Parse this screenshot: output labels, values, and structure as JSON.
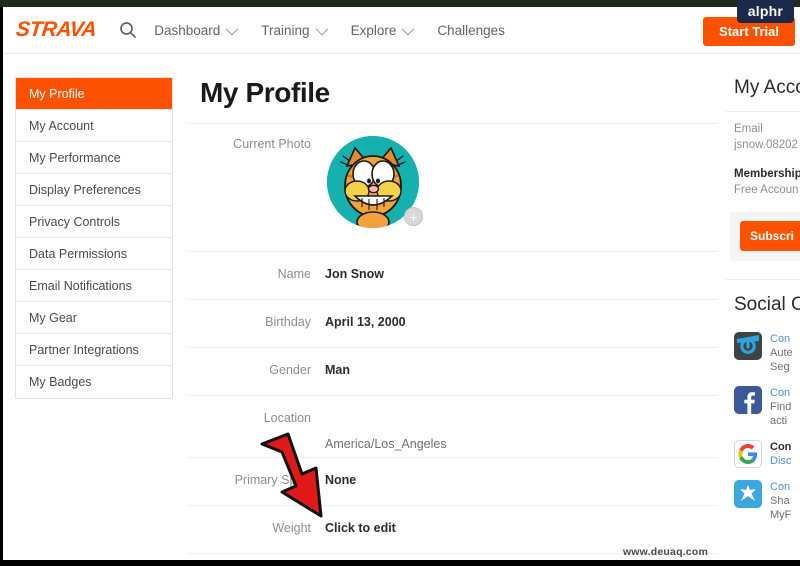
{
  "branding": {
    "site_logo": "STRAVA",
    "overlay_badge": "alphr",
    "watermark": "www.deuaq.com",
    "accent_color": "#fc5200",
    "badge_color": "#1b2a4a"
  },
  "navbar": {
    "search_icon": "search-icon",
    "items": [
      {
        "label": "Dashboard",
        "has_caret": true
      },
      {
        "label": "Training",
        "has_caret": true
      },
      {
        "label": "Explore",
        "has_caret": true
      },
      {
        "label": "Challenges",
        "has_caret": false
      }
    ],
    "cta_label": "Start Trial"
  },
  "sidebar": {
    "items": [
      {
        "label": "My Profile",
        "active": true
      },
      {
        "label": "My Account",
        "active": false
      },
      {
        "label": "My Performance",
        "active": false
      },
      {
        "label": "Display Preferences",
        "active": false
      },
      {
        "label": "Privacy Controls",
        "active": false
      },
      {
        "label": "Data Permissions",
        "active": false
      },
      {
        "label": "Email Notifications",
        "active": false
      },
      {
        "label": "My Gear",
        "active": false
      },
      {
        "label": "Partner Integrations",
        "active": false
      },
      {
        "label": "My Badges",
        "active": false
      }
    ]
  },
  "main": {
    "title": "My Profile",
    "photo_row": {
      "label": "Current Photo",
      "avatar_alt": "garfield-avatar",
      "add_badge": "+"
    },
    "fields": [
      {
        "label": "Name",
        "value": "Jon Snow",
        "style": "bold"
      },
      {
        "label": "Birthday",
        "value": "April 13, 2000",
        "style": "bold"
      },
      {
        "label": "Gender",
        "value": "Man",
        "style": "bold"
      },
      {
        "label": "Location",
        "value": "America/Los_Angeles",
        "style": "plain"
      },
      {
        "label": "Primary Sport",
        "value": "None",
        "style": "bold"
      },
      {
        "label": "Weight",
        "value": "Click to edit",
        "style": "bold"
      }
    ]
  },
  "right_panel": {
    "account_title": "My Acco",
    "email_label": "Email",
    "email_value": "jsnow.08202",
    "membership_label": "Membership",
    "membership_value": "Free Accoun",
    "subscribe_label": "Subscri",
    "social_title": "Social C",
    "connections": [
      {
        "icon": "garmin-icon",
        "link": "Con",
        "line1": "Aute",
        "line2": "Seg",
        "bold": false,
        "line2_is_link": false
      },
      {
        "icon": "facebook-icon",
        "link": "Con",
        "line1": "Find",
        "line2": "acti",
        "bold": false,
        "line2_is_link": false
      },
      {
        "icon": "google-icon",
        "link": "Con",
        "line1": "Disc",
        "line2": "",
        "bold": true,
        "line2_is_link": false
      },
      {
        "icon": "myfitnesspal-icon",
        "link": "Con",
        "line1": "Sha",
        "line2": "MyF",
        "bold": false,
        "line2_is_link": false
      }
    ]
  },
  "annotation": {
    "arrow_color": "#e11919",
    "arrow_name": "red-pointer-arrow"
  }
}
